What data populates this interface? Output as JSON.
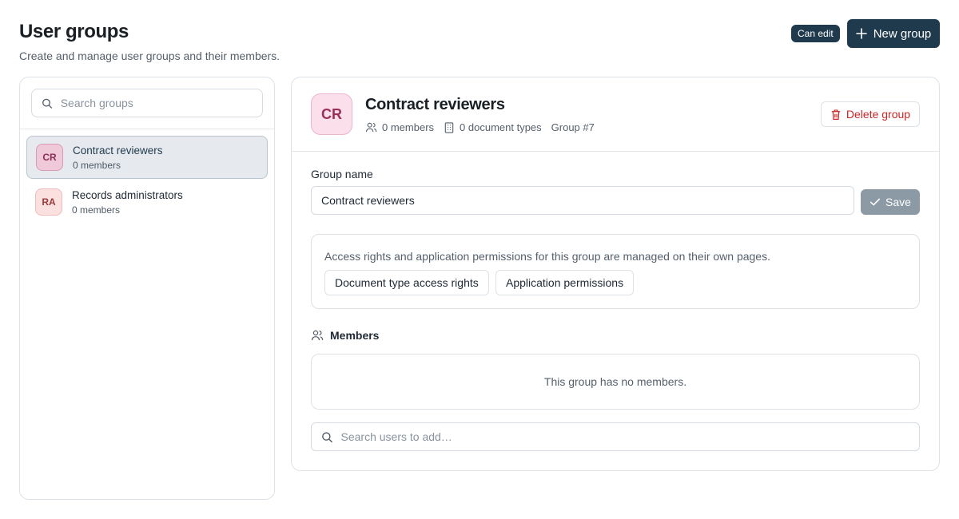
{
  "header": {
    "title": "User groups",
    "subtitle": "Create and manage user groups and their members.",
    "badge": "Can edit",
    "new_group_label": "New group"
  },
  "sidebar": {
    "search_placeholder": "Search groups",
    "groups": [
      {
        "initials": "CR",
        "name": "Contract reviewers",
        "count": "0 members",
        "selected": true,
        "avatar_bg": "#f0c9d8",
        "avatar_fg": "#8a2f55"
      },
      {
        "initials": "RA",
        "name": "Records administrators",
        "count": "0 members",
        "selected": false,
        "avatar_bg": "#fbe0e0",
        "avatar_fg": "#9a3b3b"
      }
    ]
  },
  "detail": {
    "initials": "CR",
    "title": "Contract reviewers",
    "members_count": "0 members",
    "doc_types": "0 document types",
    "group_id": "Group #7",
    "delete_label": "Delete group",
    "field_label": "Group name",
    "field_value": "Contract reviewers",
    "save_label": "Save",
    "access_text": "Access rights and application permissions for this group are managed on their own pages.",
    "access_rights_label": "Document type access rights",
    "app_permissions_label": "Application permissions",
    "members_heading": "Members",
    "empty_text": "This group has no members.",
    "search_users_placeholder": "Search users to add…"
  },
  "colors": {
    "primary": "#1f3a4d",
    "danger": "#c62828",
    "avatar_lg_bg": "#fbe0eb",
    "avatar_lg_fg": "#9a3058",
    "save_disabled": "#8c9aa5"
  }
}
